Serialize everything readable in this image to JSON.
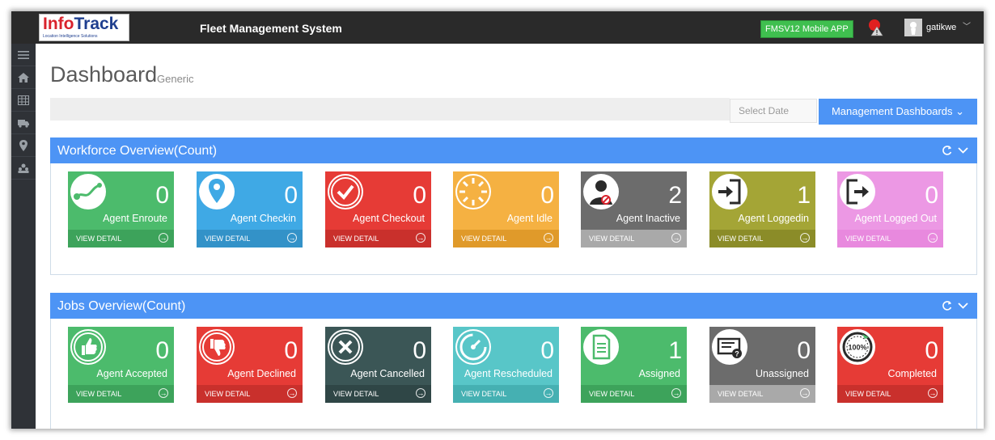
{
  "header": {
    "logo_main_a": "Info",
    "logo_main_b": "Track",
    "logo_sub": "Location Intelligence Solutions",
    "app_title": "Fleet Management System",
    "mobile_button": "FMSV12 Mobile APP",
    "user_name": "gatikwe",
    "user_caret": "﹀"
  },
  "sidebar": {
    "items": [
      {
        "icon": "menu-icon"
      },
      {
        "icon": "home-icon"
      },
      {
        "icon": "table-icon"
      },
      {
        "icon": "truck-icon"
      },
      {
        "icon": "map-marker-icon"
      },
      {
        "icon": "users-icon"
      }
    ]
  },
  "page": {
    "title": "Dashboard",
    "subtitle": "Generic",
    "date_placeholder": "Select Date",
    "management_button": "Management Dashboards ⌄"
  },
  "workforce": {
    "title": "Workforce Overview(Count)",
    "tiles": [
      {
        "label": "Agent Enroute",
        "count": "0",
        "footer": "VIEW DETAIL",
        "icon": "route-icon",
        "color": "#4cbb6c",
        "foot": "#3da35b"
      },
      {
        "label": "Agent Checkin",
        "count": "0",
        "footer": "VIEW DETAIL",
        "icon": "map-pin-icon",
        "color": "#3fa9e5",
        "foot": "#3392c8"
      },
      {
        "label": "Agent Checkout",
        "count": "0",
        "footer": "VIEW DETAIL",
        "icon": "check-circle-icon",
        "color": "#e63b36",
        "foot": "#c9302c"
      },
      {
        "label": "Agent Idle",
        "count": "0",
        "footer": "VIEW DETAIL",
        "icon": "loading-icon",
        "color": "#f5b142",
        "foot": "#e09a2a"
      },
      {
        "label": "Agent Inactive",
        "count": "2",
        "footer": "VIEW DETAIL",
        "icon": "user-blocked-icon",
        "color": "#6c6c6c",
        "foot": "#a9a9a9"
      },
      {
        "label": "Agent Loggedin",
        "count": "1",
        "footer": "VIEW DETAIL",
        "icon": "sign-in-icon",
        "color": "#a4a536",
        "foot": "#8b8c28"
      },
      {
        "label": "Agent Logged Out",
        "count": "0",
        "footer": "VIEW DETAIL",
        "icon": "sign-out-icon",
        "color": "#ec98e4",
        "foot": "#e889de"
      }
    ]
  },
  "jobs": {
    "title": "Jobs Overview(Count)",
    "tiles": [
      {
        "label": "Agent Accepted",
        "count": "0",
        "footer": "VIEW DETAIL",
        "icon": "thumbs-up-icon",
        "color": "#4cbb6c",
        "foot": "#3da35b"
      },
      {
        "label": "Agent Declined",
        "count": "0",
        "footer": "VIEW DETAIL",
        "icon": "thumbs-down-icon",
        "color": "#e63b36",
        "foot": "#c9302c"
      },
      {
        "label": "Agent Cancelled",
        "count": "0",
        "footer": "VIEW DETAIL",
        "icon": "x-circle-icon",
        "color": "#3b5656",
        "foot": "#2f4646"
      },
      {
        "label": "Agent Rescheduled",
        "count": "0",
        "footer": "VIEW DETAIL",
        "icon": "gauge-icon",
        "color": "#58c6c8",
        "foot": "#45b0b2"
      },
      {
        "label": "Assigned",
        "count": "1",
        "footer": "VIEW DETAIL",
        "icon": "document-icon",
        "color": "#4cbb6c",
        "foot": "#3da35b"
      },
      {
        "label": "Unassigned",
        "count": "0",
        "footer": "VIEW DETAIL",
        "icon": "question-doc-icon",
        "color": "#6c6c6c",
        "foot": "#a9a9a9"
      },
      {
        "label": "Completed",
        "count": "0",
        "footer": "VIEW DETAIL",
        "icon": "badge-100-icon",
        "color": "#e63b36",
        "foot": "#c9302c"
      }
    ]
  },
  "icons": {
    "badge_text": "100%"
  }
}
